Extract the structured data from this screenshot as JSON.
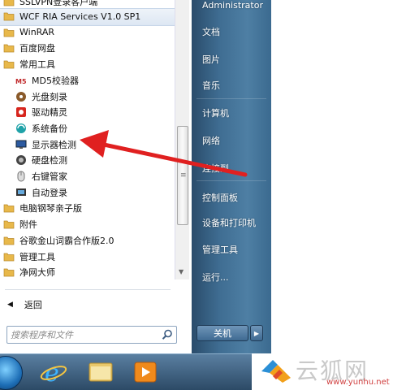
{
  "program_list": {
    "top_partial": "SSLVPN登录客户端",
    "items": [
      {
        "label": "WCF RIA Services V1.0 SP1",
        "type": "folder",
        "icon": "folder-icon"
      },
      {
        "label": "WinRAR",
        "type": "folder",
        "icon": "folder-icon"
      },
      {
        "label": "百度网盘",
        "type": "folder",
        "icon": "folder-icon"
      },
      {
        "label": "常用工具",
        "type": "folder",
        "icon": "folder-icon"
      },
      {
        "label": "MD5校验器",
        "type": "sub",
        "icon": "md5-checker-icon"
      },
      {
        "label": "光盘刻录",
        "type": "sub",
        "icon": "disc-burn-icon"
      },
      {
        "label": "驱动精灵",
        "type": "sub",
        "icon": "driver-genius-icon"
      },
      {
        "label": "系统备份",
        "type": "sub",
        "icon": "system-backup-icon"
      },
      {
        "label": "显示器检测",
        "type": "sub",
        "icon": "monitor-test-icon"
      },
      {
        "label": "硬盘检测",
        "type": "sub",
        "icon": "hard-disk-test-icon"
      },
      {
        "label": "右键管家",
        "type": "sub",
        "icon": "mouse-right-click-icon"
      },
      {
        "label": "自动登录",
        "type": "sub",
        "icon": "auto-login-icon"
      },
      {
        "label": "电脑钢琴亲子版",
        "type": "folder",
        "icon": "folder-icon"
      },
      {
        "label": "附件",
        "type": "folder",
        "icon": "folder-icon"
      },
      {
        "label": "谷歌金山词霸合作版2.0",
        "type": "folder",
        "icon": "folder-icon"
      },
      {
        "label": "管理工具",
        "type": "folder",
        "icon": "folder-icon"
      },
      {
        "label": "净网大师",
        "type": "folder",
        "icon": "folder-icon"
      }
    ],
    "back_label": "返回",
    "search_placeholder": "搜索程序和文件"
  },
  "right_panel": {
    "user": "Administrator",
    "items": [
      "文档",
      "图片",
      "音乐",
      "计算机",
      "网络",
      "控制面板",
      "设备和打印机",
      "管理工具",
      "运行..."
    ],
    "partial_item": "连接到",
    "shutdown_label": "关机"
  },
  "taskbar": {
    "icons": [
      "start-orb-icon",
      "internet-explorer-icon",
      "file-explorer-icon",
      "media-player-icon"
    ]
  },
  "watermark": {
    "title": "云狐网",
    "url": "www.yunhu.net"
  },
  "colors": {
    "right_panel": "#3f6d92",
    "annotation_arrow": "#e02020",
    "folder": "#e8b84a"
  }
}
